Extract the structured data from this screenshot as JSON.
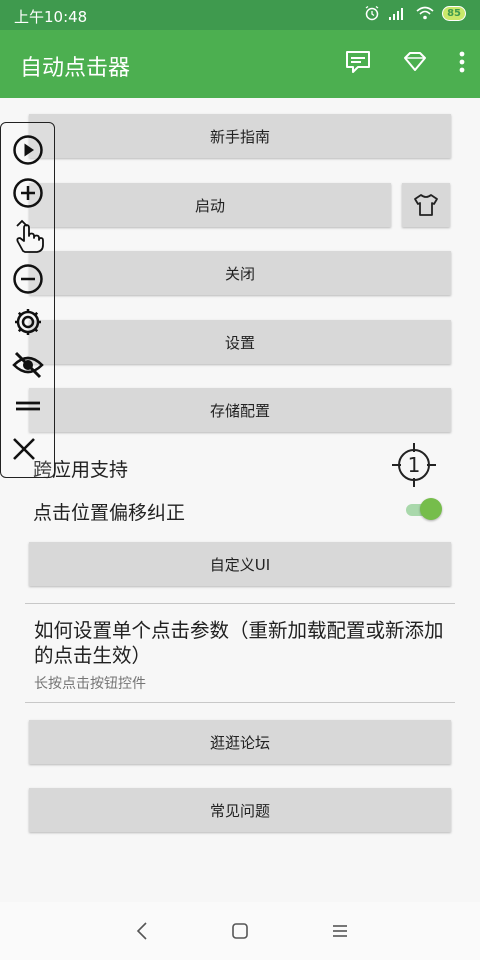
{
  "status_bar": {
    "time": "上午10:48",
    "battery": "85"
  },
  "app_bar": {
    "title": "自动点击器"
  },
  "buttons": {
    "guide": "新手指南",
    "start": "启动",
    "close": "关闭",
    "settings": "设置",
    "store_config": "存储配置",
    "custom_ui": "自定义UI",
    "forum": "逛逛论坛",
    "faq": "常见问题"
  },
  "settings_rows": {
    "cross_app_label": "跨应用支持",
    "cross_app_badge": "1",
    "offset_label": "点击位置偏移纠正",
    "offset_enabled": true
  },
  "info": {
    "title": "如何设置单个点击参数（重新加载配置或新添加的点击生效）",
    "subtitle": "长按点击按钮控件"
  },
  "colors": {
    "primary": "#4caf50",
    "status": "#3f9a4e",
    "toggle_on": "#76bd4b"
  }
}
